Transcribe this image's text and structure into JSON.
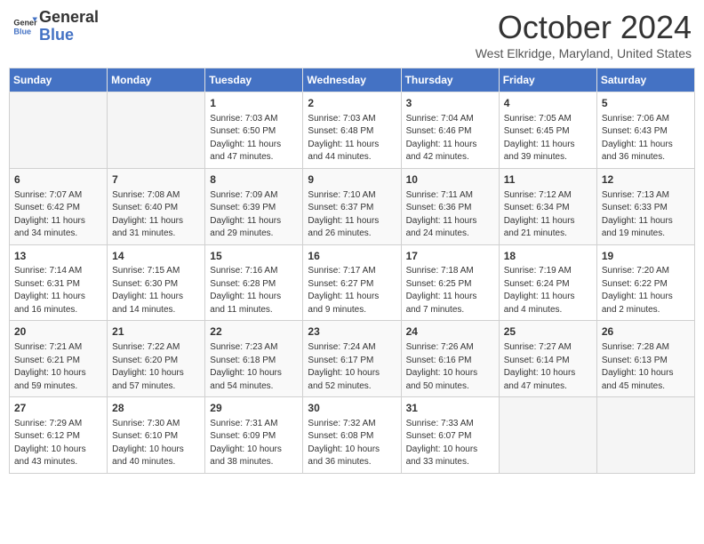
{
  "logo": {
    "line1": "General",
    "line2": "Blue"
  },
  "title": "October 2024",
  "location": "West Elkridge, Maryland, United States",
  "days_of_week": [
    "Sunday",
    "Monday",
    "Tuesday",
    "Wednesday",
    "Thursday",
    "Friday",
    "Saturday"
  ],
  "weeks": [
    [
      {
        "day": "",
        "info": ""
      },
      {
        "day": "",
        "info": ""
      },
      {
        "day": "1",
        "info": "Sunrise: 7:03 AM\nSunset: 6:50 PM\nDaylight: 11 hours and 47 minutes."
      },
      {
        "day": "2",
        "info": "Sunrise: 7:03 AM\nSunset: 6:48 PM\nDaylight: 11 hours and 44 minutes."
      },
      {
        "day": "3",
        "info": "Sunrise: 7:04 AM\nSunset: 6:46 PM\nDaylight: 11 hours and 42 minutes."
      },
      {
        "day": "4",
        "info": "Sunrise: 7:05 AM\nSunset: 6:45 PM\nDaylight: 11 hours and 39 minutes."
      },
      {
        "day": "5",
        "info": "Sunrise: 7:06 AM\nSunset: 6:43 PM\nDaylight: 11 hours and 36 minutes."
      }
    ],
    [
      {
        "day": "6",
        "info": "Sunrise: 7:07 AM\nSunset: 6:42 PM\nDaylight: 11 hours and 34 minutes."
      },
      {
        "day": "7",
        "info": "Sunrise: 7:08 AM\nSunset: 6:40 PM\nDaylight: 11 hours and 31 minutes."
      },
      {
        "day": "8",
        "info": "Sunrise: 7:09 AM\nSunset: 6:39 PM\nDaylight: 11 hours and 29 minutes."
      },
      {
        "day": "9",
        "info": "Sunrise: 7:10 AM\nSunset: 6:37 PM\nDaylight: 11 hours and 26 minutes."
      },
      {
        "day": "10",
        "info": "Sunrise: 7:11 AM\nSunset: 6:36 PM\nDaylight: 11 hours and 24 minutes."
      },
      {
        "day": "11",
        "info": "Sunrise: 7:12 AM\nSunset: 6:34 PM\nDaylight: 11 hours and 21 minutes."
      },
      {
        "day": "12",
        "info": "Sunrise: 7:13 AM\nSunset: 6:33 PM\nDaylight: 11 hours and 19 minutes."
      }
    ],
    [
      {
        "day": "13",
        "info": "Sunrise: 7:14 AM\nSunset: 6:31 PM\nDaylight: 11 hours and 16 minutes."
      },
      {
        "day": "14",
        "info": "Sunrise: 7:15 AM\nSunset: 6:30 PM\nDaylight: 11 hours and 14 minutes."
      },
      {
        "day": "15",
        "info": "Sunrise: 7:16 AM\nSunset: 6:28 PM\nDaylight: 11 hours and 11 minutes."
      },
      {
        "day": "16",
        "info": "Sunrise: 7:17 AM\nSunset: 6:27 PM\nDaylight: 11 hours and 9 minutes."
      },
      {
        "day": "17",
        "info": "Sunrise: 7:18 AM\nSunset: 6:25 PM\nDaylight: 11 hours and 7 minutes."
      },
      {
        "day": "18",
        "info": "Sunrise: 7:19 AM\nSunset: 6:24 PM\nDaylight: 11 hours and 4 minutes."
      },
      {
        "day": "19",
        "info": "Sunrise: 7:20 AM\nSunset: 6:22 PM\nDaylight: 11 hours and 2 minutes."
      }
    ],
    [
      {
        "day": "20",
        "info": "Sunrise: 7:21 AM\nSunset: 6:21 PM\nDaylight: 10 hours and 59 minutes."
      },
      {
        "day": "21",
        "info": "Sunrise: 7:22 AM\nSunset: 6:20 PM\nDaylight: 10 hours and 57 minutes."
      },
      {
        "day": "22",
        "info": "Sunrise: 7:23 AM\nSunset: 6:18 PM\nDaylight: 10 hours and 54 minutes."
      },
      {
        "day": "23",
        "info": "Sunrise: 7:24 AM\nSunset: 6:17 PM\nDaylight: 10 hours and 52 minutes."
      },
      {
        "day": "24",
        "info": "Sunrise: 7:26 AM\nSunset: 6:16 PM\nDaylight: 10 hours and 50 minutes."
      },
      {
        "day": "25",
        "info": "Sunrise: 7:27 AM\nSunset: 6:14 PM\nDaylight: 10 hours and 47 minutes."
      },
      {
        "day": "26",
        "info": "Sunrise: 7:28 AM\nSunset: 6:13 PM\nDaylight: 10 hours and 45 minutes."
      }
    ],
    [
      {
        "day": "27",
        "info": "Sunrise: 7:29 AM\nSunset: 6:12 PM\nDaylight: 10 hours and 43 minutes."
      },
      {
        "day": "28",
        "info": "Sunrise: 7:30 AM\nSunset: 6:10 PM\nDaylight: 10 hours and 40 minutes."
      },
      {
        "day": "29",
        "info": "Sunrise: 7:31 AM\nSunset: 6:09 PM\nDaylight: 10 hours and 38 minutes."
      },
      {
        "day": "30",
        "info": "Sunrise: 7:32 AM\nSunset: 6:08 PM\nDaylight: 10 hours and 36 minutes."
      },
      {
        "day": "31",
        "info": "Sunrise: 7:33 AM\nSunset: 6:07 PM\nDaylight: 10 hours and 33 minutes."
      },
      {
        "day": "",
        "info": ""
      },
      {
        "day": "",
        "info": ""
      }
    ]
  ]
}
